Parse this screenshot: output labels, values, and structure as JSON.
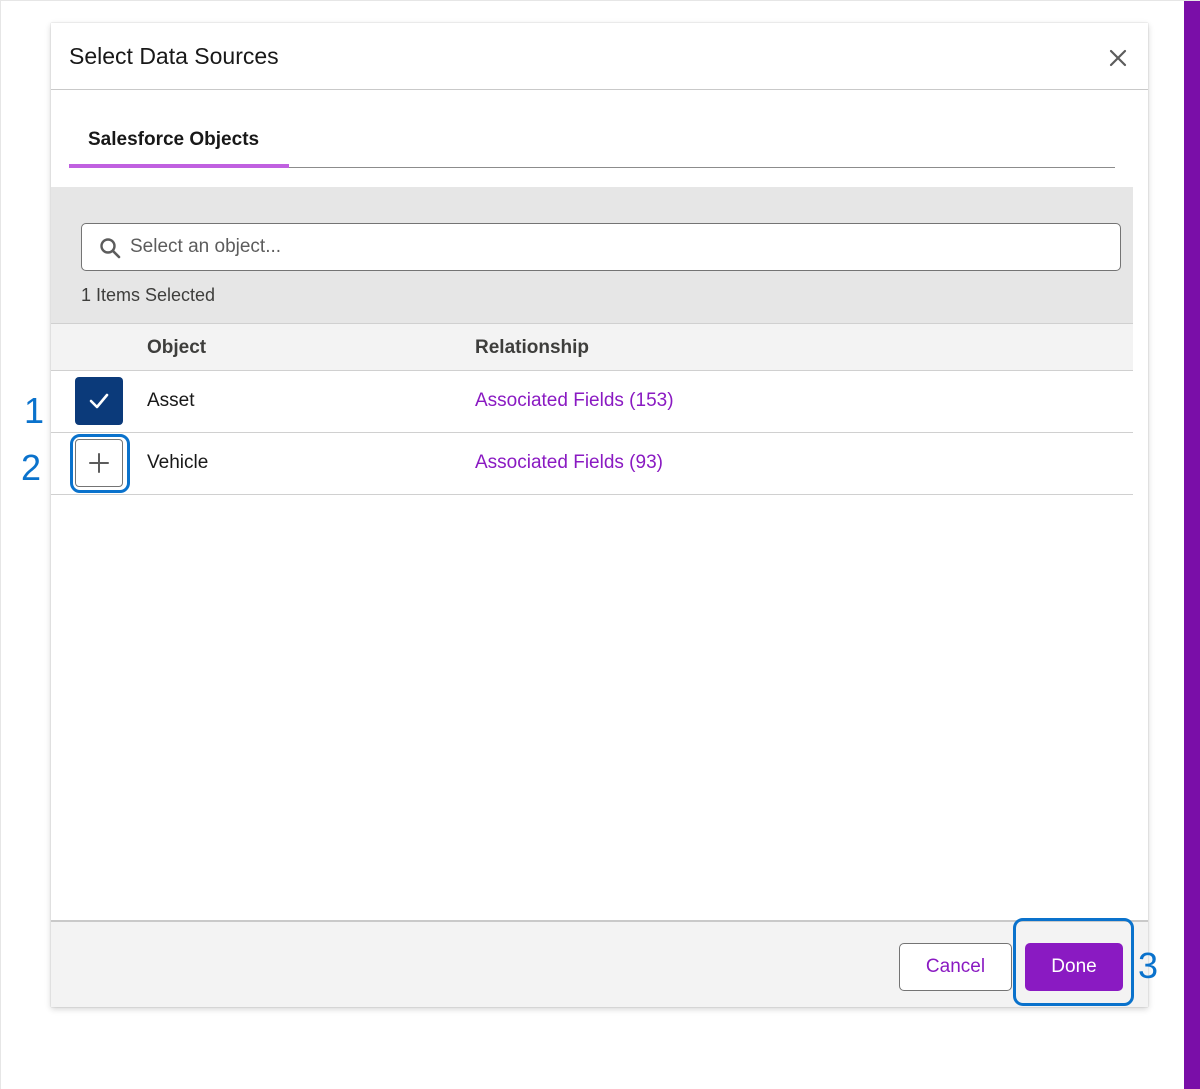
{
  "modal": {
    "title": "Select Data Sources",
    "close_icon": "close-icon"
  },
  "tabs": [
    {
      "label": "Salesforce Objects",
      "active": true
    }
  ],
  "search": {
    "placeholder": "Select an object...",
    "value": "",
    "icon": "search-icon"
  },
  "selection": {
    "count_text": "1 Items Selected"
  },
  "table": {
    "columns": [
      "Object",
      "Relationship"
    ],
    "rows": [
      {
        "object": "Asset",
        "relationship": "Associated Fields (153)",
        "selected": true,
        "control_icon": "check-icon"
      },
      {
        "object": "Vehicle",
        "relationship": "Associated Fields (93)",
        "selected": false,
        "control_icon": "plus-icon"
      }
    ]
  },
  "footer": {
    "cancel_label": "Cancel",
    "done_label": "Done"
  },
  "callouts": [
    "1",
    "2",
    "3"
  ],
  "colors": {
    "brand_purple": "#8a1ac2",
    "tab_underline": "#c060e0",
    "checkbox_selected": "#0b3a7a",
    "callout_blue": "#0a72cc",
    "right_accent": "#7a0ea8"
  }
}
